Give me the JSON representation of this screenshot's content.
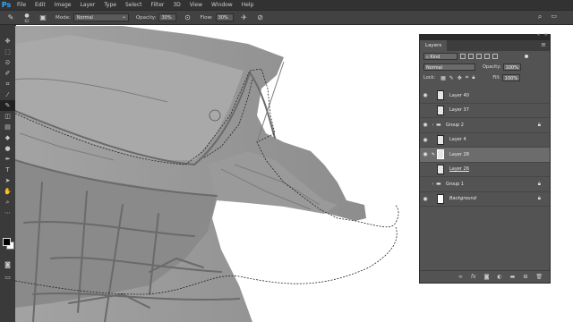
{
  "app": {
    "logo": "Ps"
  },
  "menu": [
    "File",
    "Edit",
    "Image",
    "Layer",
    "Type",
    "Select",
    "Filter",
    "3D",
    "View",
    "Window",
    "Help"
  ],
  "options": {
    "brush_size": "63",
    "mode_label": "Mode:",
    "mode_value": "Normal",
    "opacity_label": "Opacity:",
    "opacity_value": "30%",
    "flow_label": "Flow:",
    "flow_value": "30%"
  },
  "layers_panel": {
    "tab": "Layers",
    "filter_kind": "Kind",
    "blend_mode": "Normal",
    "opacity_label": "Opacity:",
    "opacity_value": "100%",
    "lock_label": "Lock:",
    "fill_label": "Fill:",
    "fill_value": "100%",
    "layers": [
      {
        "name": "Layer 40",
        "visible": true,
        "type": "layer"
      },
      {
        "name": "Layer 37",
        "visible": false,
        "type": "layer"
      },
      {
        "name": "Group 2",
        "visible": true,
        "type": "group",
        "locked": true
      },
      {
        "name": "Layer 4",
        "visible": true,
        "type": "layer"
      },
      {
        "name": "Layer 28",
        "visible": true,
        "type": "layer",
        "selected": true
      },
      {
        "name": "Layer 26",
        "visible": false,
        "type": "layer"
      },
      {
        "name": "Group 1",
        "visible": false,
        "type": "group",
        "locked": true
      },
      {
        "name": "Background",
        "visible": true,
        "type": "background",
        "locked": true
      }
    ]
  },
  "colors": {
    "app_bg": "#535353",
    "menubar": "#323232",
    "selected_layer": "#6c6c6c",
    "ps_blue": "#31a8ff"
  }
}
